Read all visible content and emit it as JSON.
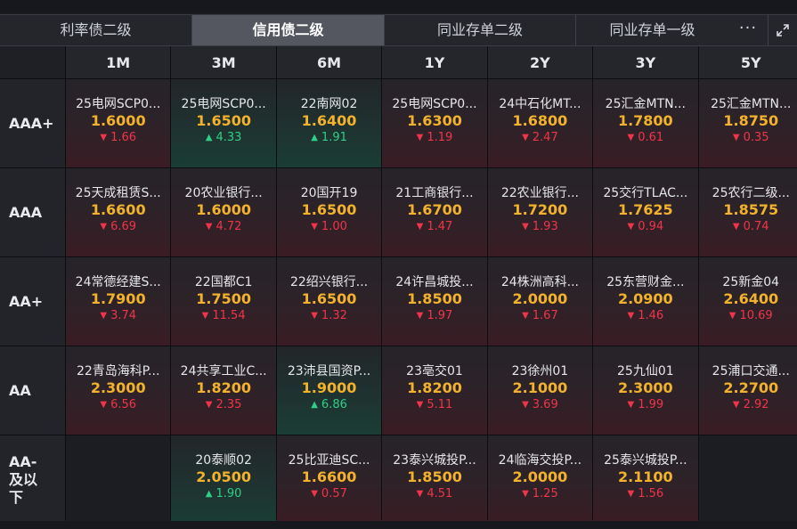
{
  "tabs": [
    {
      "label": "利率债二级",
      "active": false
    },
    {
      "label": "信用债二级",
      "active": true
    },
    {
      "label": "同业存单二级",
      "active": false
    },
    {
      "label": "同业存单一级",
      "active": false
    }
  ],
  "more_label": "···",
  "columns": [
    "1M",
    "3M",
    "6M",
    "1Y",
    "2Y",
    "3Y",
    "5Y"
  ],
  "rows": [
    {
      "rating": "AAA+",
      "cells": [
        {
          "name": "25电网SCP0...",
          "yield": "1.6000",
          "change": "1.66",
          "dir": "down"
        },
        {
          "name": "25电网SCP0...",
          "yield": "1.6500",
          "change": "4.33",
          "dir": "up"
        },
        {
          "name": "22南网02",
          "yield": "1.6400",
          "change": "1.91",
          "dir": "up"
        },
        {
          "name": "25电网SCP0...",
          "yield": "1.6300",
          "change": "1.19",
          "dir": "down"
        },
        {
          "name": "24中石化MT...",
          "yield": "1.6800",
          "change": "2.47",
          "dir": "down"
        },
        {
          "name": "25汇金MTN...",
          "yield": "1.7800",
          "change": "0.61",
          "dir": "down"
        },
        {
          "name": "25汇金MTN...",
          "yield": "1.8750",
          "change": "0.35",
          "dir": "down"
        }
      ]
    },
    {
      "rating": "AAA",
      "cells": [
        {
          "name": "25天成租赁S...",
          "yield": "1.6600",
          "change": "6.69",
          "dir": "down"
        },
        {
          "name": "20农业银行...",
          "yield": "1.6000",
          "change": "4.72",
          "dir": "down"
        },
        {
          "name": "20国开19",
          "yield": "1.6500",
          "change": "1.00",
          "dir": "down"
        },
        {
          "name": "21工商银行...",
          "yield": "1.6700",
          "change": "1.47",
          "dir": "down"
        },
        {
          "name": "22农业银行...",
          "yield": "1.7200",
          "change": "1.93",
          "dir": "down"
        },
        {
          "name": "25交行TLAC...",
          "yield": "1.7625",
          "change": "0.94",
          "dir": "down"
        },
        {
          "name": "25农行二级...",
          "yield": "1.8575",
          "change": "0.74",
          "dir": "down"
        }
      ]
    },
    {
      "rating": "AA+",
      "cells": [
        {
          "name": "24常德经建S...",
          "yield": "1.7900",
          "change": "3.74",
          "dir": "down"
        },
        {
          "name": "22国都C1",
          "yield": "1.7500",
          "change": "11.54",
          "dir": "down"
        },
        {
          "name": "22绍兴银行...",
          "yield": "1.6500",
          "change": "1.32",
          "dir": "down"
        },
        {
          "name": "24许昌城投...",
          "yield": "1.8500",
          "change": "1.97",
          "dir": "down"
        },
        {
          "name": "24株洲高科...",
          "yield": "2.0000",
          "change": "1.67",
          "dir": "down"
        },
        {
          "name": "25东营财金...",
          "yield": "2.0900",
          "change": "1.46",
          "dir": "down"
        },
        {
          "name": "25新金04",
          "yield": "2.6400",
          "change": "10.69",
          "dir": "down"
        }
      ]
    },
    {
      "rating": "AA",
      "cells": [
        {
          "name": "22青岛海科P...",
          "yield": "2.3000",
          "change": "6.56",
          "dir": "down"
        },
        {
          "name": "24共享工业C...",
          "yield": "1.8200",
          "change": "2.35",
          "dir": "down"
        },
        {
          "name": "23沛县国资P...",
          "yield": "1.9000",
          "change": "6.86",
          "dir": "up"
        },
        {
          "name": "23亳交01",
          "yield": "1.8200",
          "change": "5.11",
          "dir": "down"
        },
        {
          "name": "23徐州01",
          "yield": "2.1000",
          "change": "3.69",
          "dir": "down"
        },
        {
          "name": "25九仙01",
          "yield": "2.3000",
          "change": "1.99",
          "dir": "down"
        },
        {
          "name": "25浦口交通...",
          "yield": "2.2700",
          "change": "2.92",
          "dir": "down"
        }
      ]
    },
    {
      "rating": "AA-及以下",
      "cells": [
        null,
        {
          "name": "20泰顺02",
          "yield": "2.0500",
          "change": "1.90",
          "dir": "up"
        },
        {
          "name": "25比亚迪SC...",
          "yield": "1.6600",
          "change": "0.57",
          "dir": "down"
        },
        {
          "name": "23泰兴城投P...",
          "yield": "1.8500",
          "change": "4.51",
          "dir": "down"
        },
        {
          "name": "24临海交投P...",
          "yield": "2.0000",
          "change": "1.25",
          "dir": "down"
        },
        {
          "name": "25泰兴城投P...",
          "yield": "2.1100",
          "change": "1.56",
          "dir": "down"
        },
        null
      ]
    }
  ],
  "colors": {
    "yield": "#f2b22c",
    "down": "#f0354a",
    "up": "#2fcf88"
  }
}
